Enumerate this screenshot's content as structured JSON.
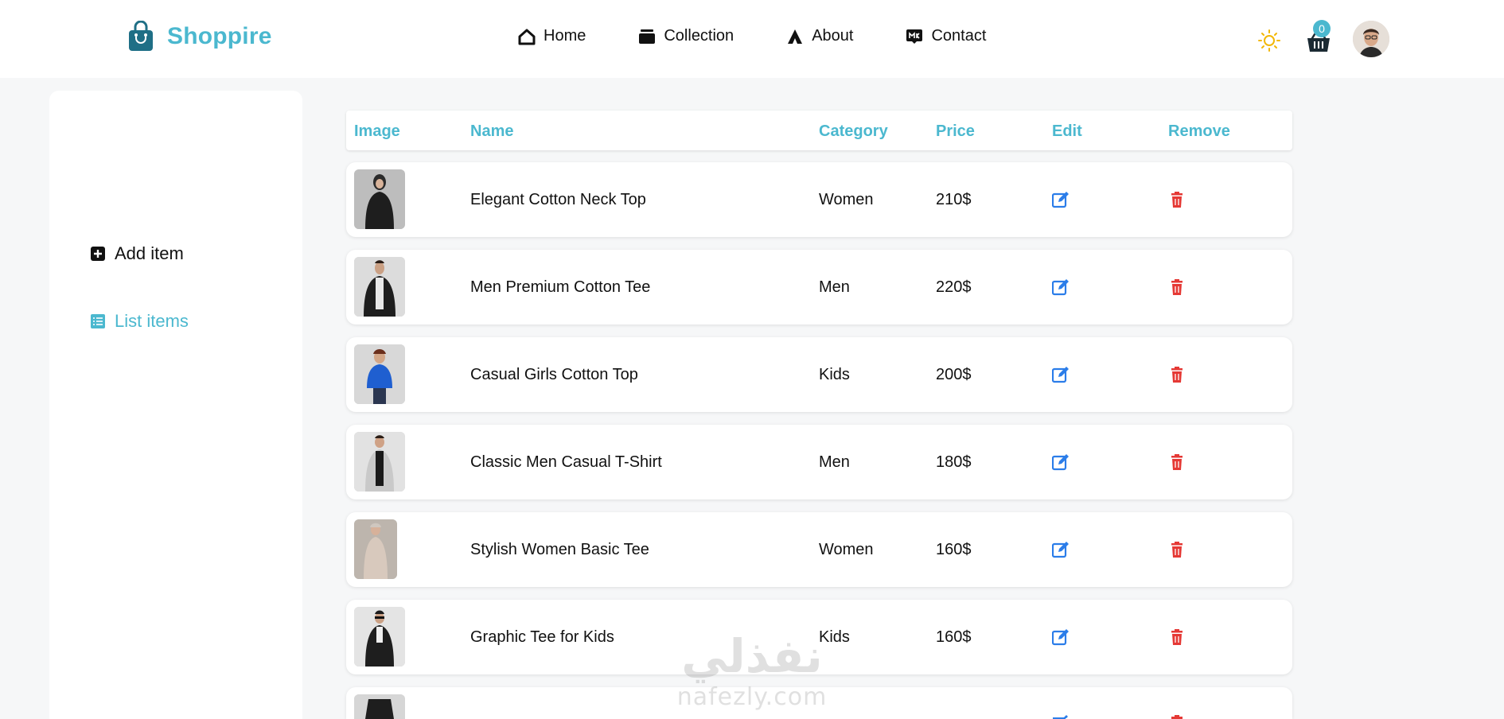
{
  "brand": {
    "name": "Shoppire",
    "icon": "shopping-bag-icon",
    "color": "#4bb8cf"
  },
  "nav": {
    "links": [
      {
        "label": "Home",
        "icon": "home-icon"
      },
      {
        "label": "Collection",
        "icon": "collection-icon"
      },
      {
        "label": "About",
        "icon": "about-icon"
      },
      {
        "label": "Contact",
        "icon": "contact-icon"
      }
    ],
    "cart_count": "0"
  },
  "sidebar": {
    "items": [
      {
        "label": "Add item",
        "icon": "plus-square-icon",
        "active": false
      },
      {
        "label": "List items",
        "icon": "list-icon",
        "active": true
      }
    ]
  },
  "table": {
    "headers": [
      "Image",
      "Name",
      "Category",
      "Price",
      "Edit",
      "Remove"
    ],
    "rows": [
      {
        "name": "Elegant Cotton Neck Top",
        "category": "Women",
        "price": "210$"
      },
      {
        "name": "Men Premium Cotton Tee",
        "category": "Men",
        "price": "220$"
      },
      {
        "name": "Casual Girls Cotton Top",
        "category": "Kids",
        "price": "200$"
      },
      {
        "name": "Classic Men Casual T-Shirt",
        "category": "Men",
        "price": "180$"
      },
      {
        "name": "Stylish Women Basic Tee",
        "category": "Women",
        "price": "160$"
      },
      {
        "name": "Graphic Tee for Kids",
        "category": "Kids",
        "price": "160$"
      },
      {
        "name": "",
        "category": "",
        "price": ""
      }
    ]
  },
  "watermark": {
    "arabic": "نفذلي",
    "latin": "nafezly.com"
  },
  "colors": {
    "accent": "#4bb8cf",
    "edit": "#2b7de9",
    "remove": "#e53935",
    "sun": "#f2b705"
  }
}
